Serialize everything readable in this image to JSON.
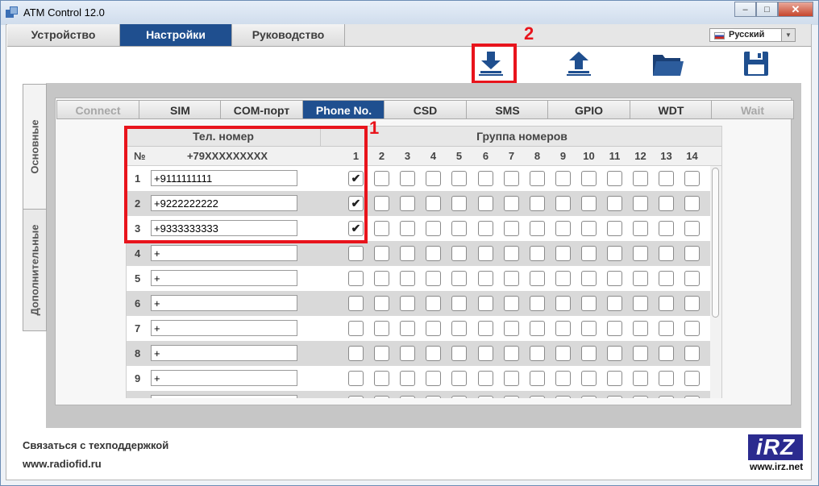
{
  "window": {
    "title": "ATM Control 12.0",
    "close_glyph": "✕",
    "min_glyph": "‒",
    "max_glyph": "□"
  },
  "menu": {
    "tabs": [
      "Устройство",
      "Настройки",
      "Руководство"
    ],
    "active": 1
  },
  "language": {
    "value": "Русский"
  },
  "toolbar": {
    "icons": [
      "download-icon",
      "upload-icon",
      "folder-icon",
      "save-icon"
    ]
  },
  "annotations": {
    "label1": "1",
    "label2": "2",
    "color": "#e8141c"
  },
  "side_tabs": [
    "Основные",
    "Дополнительные"
  ],
  "settings_tabs": [
    {
      "label": "Connect",
      "state": "disabled"
    },
    {
      "label": "SIM",
      "state": "normal"
    },
    {
      "label": "COM-порт",
      "state": "normal"
    },
    {
      "label": "Phone No.",
      "state": "active"
    },
    {
      "label": "CSD",
      "state": "normal"
    },
    {
      "label": "SMS",
      "state": "normal"
    },
    {
      "label": "GPIO",
      "state": "normal"
    },
    {
      "label": "WDT",
      "state": "normal"
    },
    {
      "label": "Wait",
      "state": "disabled"
    }
  ],
  "grid": {
    "phone_header": "Тел. номер",
    "group_header": "Группа номеров",
    "num_header": "№",
    "phone_hint": "+79XXXXXXXXX",
    "groups": [
      "1",
      "2",
      "3",
      "4",
      "5",
      "6",
      "7",
      "8",
      "9",
      "10",
      "11",
      "12",
      "13",
      "14"
    ],
    "rows": [
      {
        "n": "1",
        "phone": "+9111111111",
        "checked": [
          1
        ]
      },
      {
        "n": "2",
        "phone": "+9222222222",
        "checked": [
          1
        ]
      },
      {
        "n": "3",
        "phone": "+9333333333",
        "checked": [
          1
        ]
      },
      {
        "n": "4",
        "phone": "+",
        "checked": []
      },
      {
        "n": "5",
        "phone": "+",
        "checked": []
      },
      {
        "n": "6",
        "phone": "+",
        "checked": []
      },
      {
        "n": "7",
        "phone": "+",
        "checked": []
      },
      {
        "n": "8",
        "phone": "+",
        "checked": []
      },
      {
        "n": "9",
        "phone": "+",
        "checked": []
      },
      {
        "n": "",
        "phone": "",
        "checked": []
      }
    ]
  },
  "footer": {
    "support": "Связаться с техподдержкой",
    "website": "www.radiofid.ru"
  },
  "logo": {
    "word": "iRZ",
    "url": "www.irz.net"
  },
  "colors": {
    "accent": "#1f4f8f",
    "row_alt": "#d9d9d9"
  }
}
